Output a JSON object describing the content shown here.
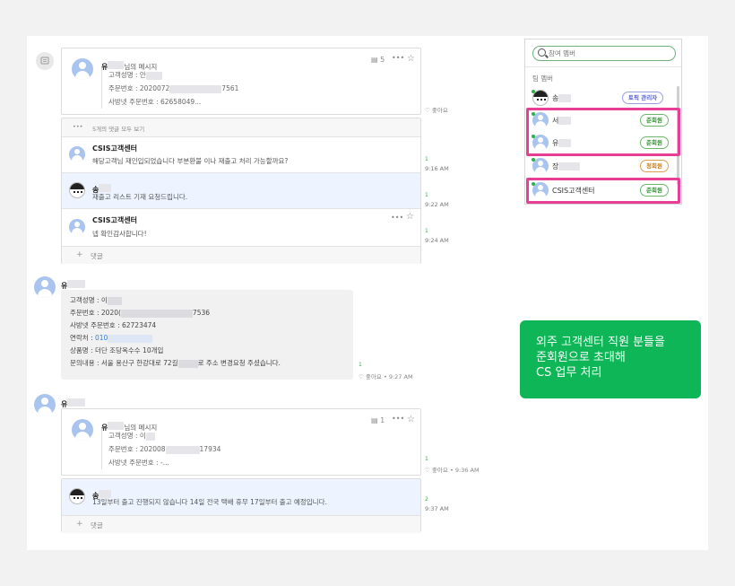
{
  "thread": {
    "msg1": {
      "sender": "유",
      "suffix": "님의 메시지",
      "count": "5",
      "lines": [
        "고객성명 : 안",
        "주문번호 : 2020072",
        "7561",
        "사방넷 주문번호 : 62658049..."
      ],
      "like": "좋아요",
      "all_comments": "5개의 댓글 모두 보기",
      "comments": [
        {
          "name": "CSIS고객센터",
          "text": "해당고객님 재인입되었습니다 부분환불 이나 재출고 처리 가능할까요?",
          "read": "1",
          "time": "9:16 AM"
        },
        {
          "name": "송",
          "text": "재출고 리스트 기재 요청드립니다.",
          "read": "1",
          "time": "9:22 AM"
        },
        {
          "name": "CSIS고객센터",
          "text": "넵 확인감사합니다!",
          "read": "1",
          "time": "9:24 AM"
        }
      ],
      "add_comment": "댓글"
    },
    "msg2": {
      "sender": "유",
      "lines": [
        "고객성명 : 이",
        "주문번호 : 2020(",
        "7536",
        "사방넷 주문번호 : 62723474",
        "연락처 : ",
        "010",
        "상품명 : 더단 조당옥수수 10개입",
        "문의내용 : 서울 용산구 한강대로 72길",
        "로 주소 변경요청 주셨습니다."
      ],
      "read": "1",
      "like": "좋아요",
      "time": "• 9:27 AM"
    },
    "msg3": {
      "sender": "유",
      "inner_sender": "유",
      "suffix": "님의 메시지",
      "count": "1",
      "lines": [
        "고객성명 : 이",
        "주문번호 : 202008",
        "17934",
        "사방넷 주문번호 : -..."
      ],
      "read": "1",
      "like": "좋아요",
      "time": "• 9:36 AM",
      "comment": {
        "name": "송",
        "text": "13일부터 출고 진행되지 않습니다 14일 전국 택배 휴무 17일부터 출고 예정입니다.",
        "read": "2",
        "time": "9:37 AM"
      },
      "add_comment": "댓글"
    }
  },
  "members": {
    "search_placeholder": "참여 멤버",
    "header": "팀 멤버",
    "list": [
      {
        "name": "송",
        "badge": "토픽 관리자",
        "badge_color": "#5560c8"
      },
      {
        "name": "서",
        "badge": "준회원",
        "badge_color": "#2f8f2f"
      },
      {
        "name": "유",
        "badge": "준회원",
        "badge_color": "#2f8f2f"
      },
      {
        "name": "장",
        "badge": "정회원",
        "badge_color": "#c77a14"
      },
      {
        "name": "CSIS고객센터",
        "badge": "준회원",
        "badge_color": "#2f8f2f"
      }
    ]
  },
  "callout": {
    "lines": [
      "외주 고객센터 직원 분들을",
      "준회원으로 초대해",
      "CS 업무 처리"
    ],
    "color": "#0fb657",
    "highlight_color": "#e83e96"
  }
}
